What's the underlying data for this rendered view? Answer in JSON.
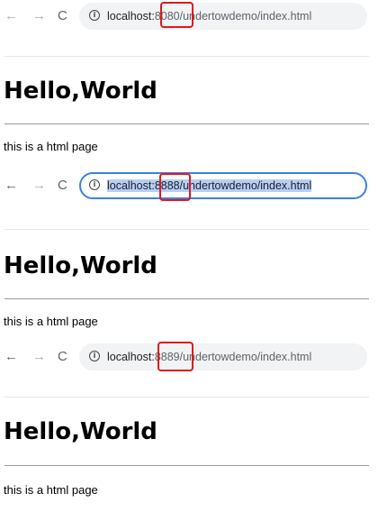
{
  "browsers": [
    {
      "nav": {
        "back": "←",
        "forward": "→",
        "reload": "C"
      },
      "url": {
        "host": "localhost:",
        "port": "8080",
        "path": "/undertowdemo/index.html"
      },
      "focused": false,
      "page": {
        "title": "Hello,World",
        "text": "this is a html page"
      }
    },
    {
      "nav": {
        "back": "←",
        "forward": "→",
        "reload": "C"
      },
      "url": {
        "host": "localhost:",
        "port": "8888",
        "path": "/undertowdemo/index.html"
      },
      "focused": true,
      "page": {
        "title": "Hello,World",
        "text": "this is a html page"
      }
    },
    {
      "nav": {
        "back": "←",
        "forward": "→",
        "reload": "C"
      },
      "url": {
        "host": "localhost:",
        "port": "8889",
        "path": "/undertowdemo/index.html"
      },
      "focused": false,
      "page": {
        "title": "Hello,World",
        "text": "this is a html page"
      }
    }
  ],
  "icons": {
    "info": "ⓘ"
  },
  "colors": {
    "annotation_box": "#e0191d",
    "focus_ring": "#3b82e0",
    "selection": "#b5cef5"
  }
}
